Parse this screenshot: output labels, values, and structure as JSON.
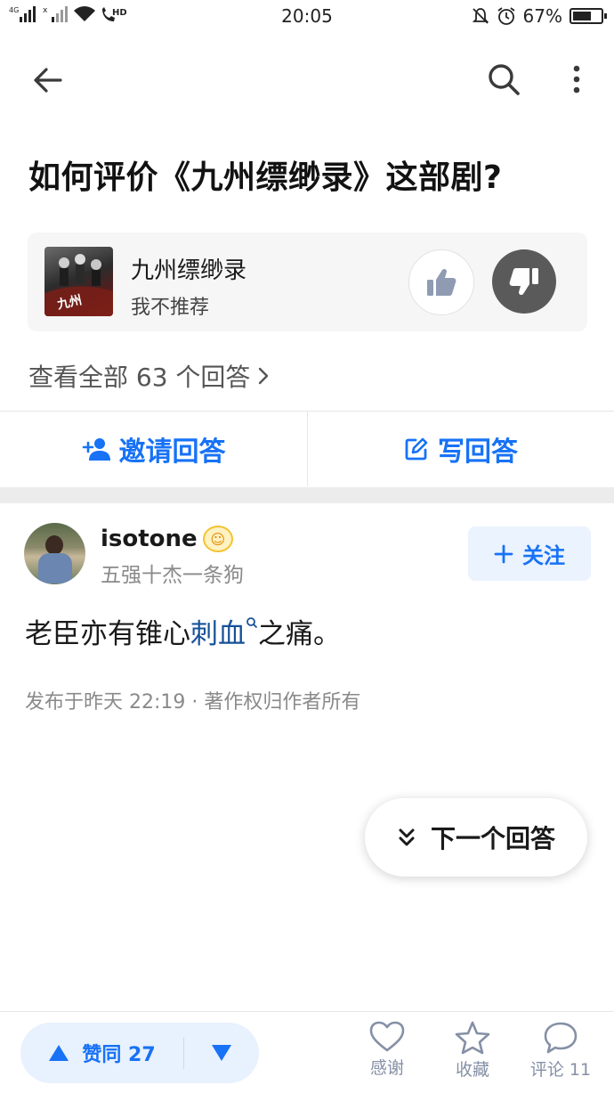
{
  "status_bar": {
    "network_1": "4G",
    "network_2": "HD",
    "time": "20:05",
    "battery_percent_label": "67%",
    "battery_level": 0.67
  },
  "nav": {
    "back_icon": "arrow-left-icon",
    "search_icon": "search-icon",
    "more_icon": "more-vertical-icon"
  },
  "question": {
    "title": "如何评价《九州缥缈录》这部剧?"
  },
  "drama_card": {
    "poster_text": "九州",
    "name": "九州缥缈录",
    "verdict": "我不推荐",
    "thumb_up_icon": "thumbs-up-icon",
    "thumb_down_icon": "thumbs-down-icon"
  },
  "view_all": {
    "label": "查看全部 63 个回答"
  },
  "actions": {
    "invite_label": "邀请回答",
    "write_label": "写回答"
  },
  "answer": {
    "author_name": "isotone",
    "author_bio": "五强十杰一条狗",
    "follow_label": "关注",
    "text_before": "老臣亦有锥心",
    "text_link": "刺血",
    "text_after": "之痛。",
    "meta": "发布于昨天 22:19 · 著作权归作者所有"
  },
  "next_answer": {
    "label": "下一个回答"
  },
  "bottom_bar": {
    "vote_label": "赞同 27",
    "thanks_label": "感谢",
    "favorite_label": "收藏",
    "comment_label": "评论 11"
  },
  "colors": {
    "accent": "#1772f6",
    "link": "#175199",
    "muted": "#8a8a8a"
  }
}
